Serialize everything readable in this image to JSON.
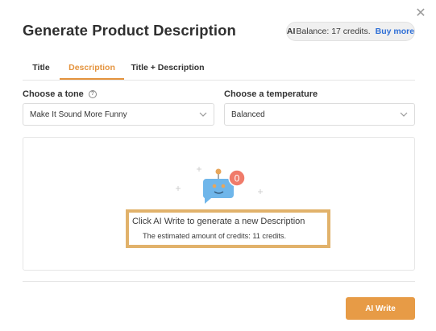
{
  "modal": {
    "title": "Generate Product Description"
  },
  "balance": {
    "ai_mark": "AI",
    "text": "Balance: 17 credits.",
    "buy_more": "Buy more"
  },
  "tabs": [
    {
      "label": "Title",
      "active": false
    },
    {
      "label": "Description",
      "active": true
    },
    {
      "label": "Title + Description",
      "active": false
    }
  ],
  "tone": {
    "label": "Choose a tone",
    "help_icon": "question-circle-icon",
    "value": "Make It Sound More Funny"
  },
  "temperature": {
    "label": "Choose a temperature",
    "value": "Balanced"
  },
  "empty_state": {
    "badge_count": "0",
    "message": "Click AI Write to generate a new Description",
    "credits_note": "The estimated amount of credits: 11 credits."
  },
  "actions": {
    "ai_write": "AI Write"
  },
  "colors": {
    "accent": "#e4933d",
    "button": "#e79b46",
    "link": "#2f6fd6",
    "robot_body": "#6fb6ea",
    "badge": "#f07b6a",
    "highlight_frame": "#e1b26b"
  }
}
